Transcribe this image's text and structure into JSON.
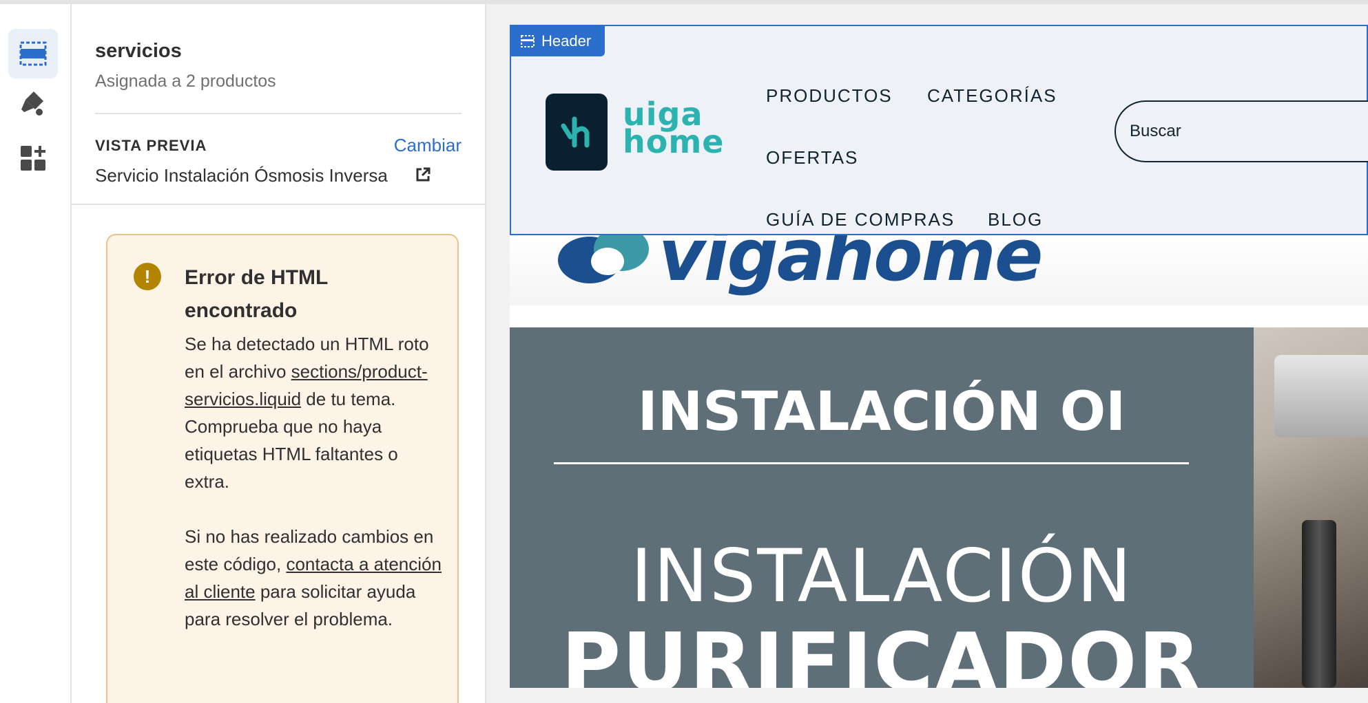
{
  "rail": {
    "items": [
      {
        "icon": "sections-icon",
        "active": true
      },
      {
        "icon": "theme-settings-icon",
        "active": false
      },
      {
        "icon": "app-blocks-icon",
        "active": false
      }
    ]
  },
  "template": {
    "name": "servicios",
    "assigned": "Asignada a 2 productos"
  },
  "preview": {
    "label": "VISTA PREVIA",
    "change_label": "Cambiar",
    "value": "Servicio Instalación Ósmosis Inversa"
  },
  "error": {
    "title": "Error de HTML encontrado",
    "p1_before": "Se ha detectado un HTML roto en el archivo ",
    "p1_link": "sections/product-servicios.liquid",
    "p1_after": " de tu tema. Comprueba que no haya etiquetas HTML faltantes o extra.",
    "p2_before": "Si no has realizado cambios en este código, ",
    "p2_link": "contacta a atención al cliente",
    "p2_after": " para solicitar ayuda para resolver el problema."
  },
  "store": {
    "section_tag": "Header",
    "logo_text_line1": "uiga",
    "logo_text_line2": "home",
    "nav": [
      "PRODUCTOS",
      "CATEGORÍAS",
      "OFERTAS",
      "GUÍA DE COMPRAS",
      "BLOG"
    ],
    "search_placeholder": "Buscar",
    "brand_banner_text": "vigahome",
    "banner_title": "INSTALACIÓN OI",
    "banner_line2": "INSTALACIÓN",
    "banner_line3": "PURIFICADOR"
  },
  "colors": {
    "accent": "#2c6ecb",
    "warning_bg": "#fdf3e7",
    "warning_border": "#eac28a",
    "warning_icon": "#b28400",
    "logo_teal": "#2cb3b0",
    "banner_bg": "#5f6f78"
  }
}
